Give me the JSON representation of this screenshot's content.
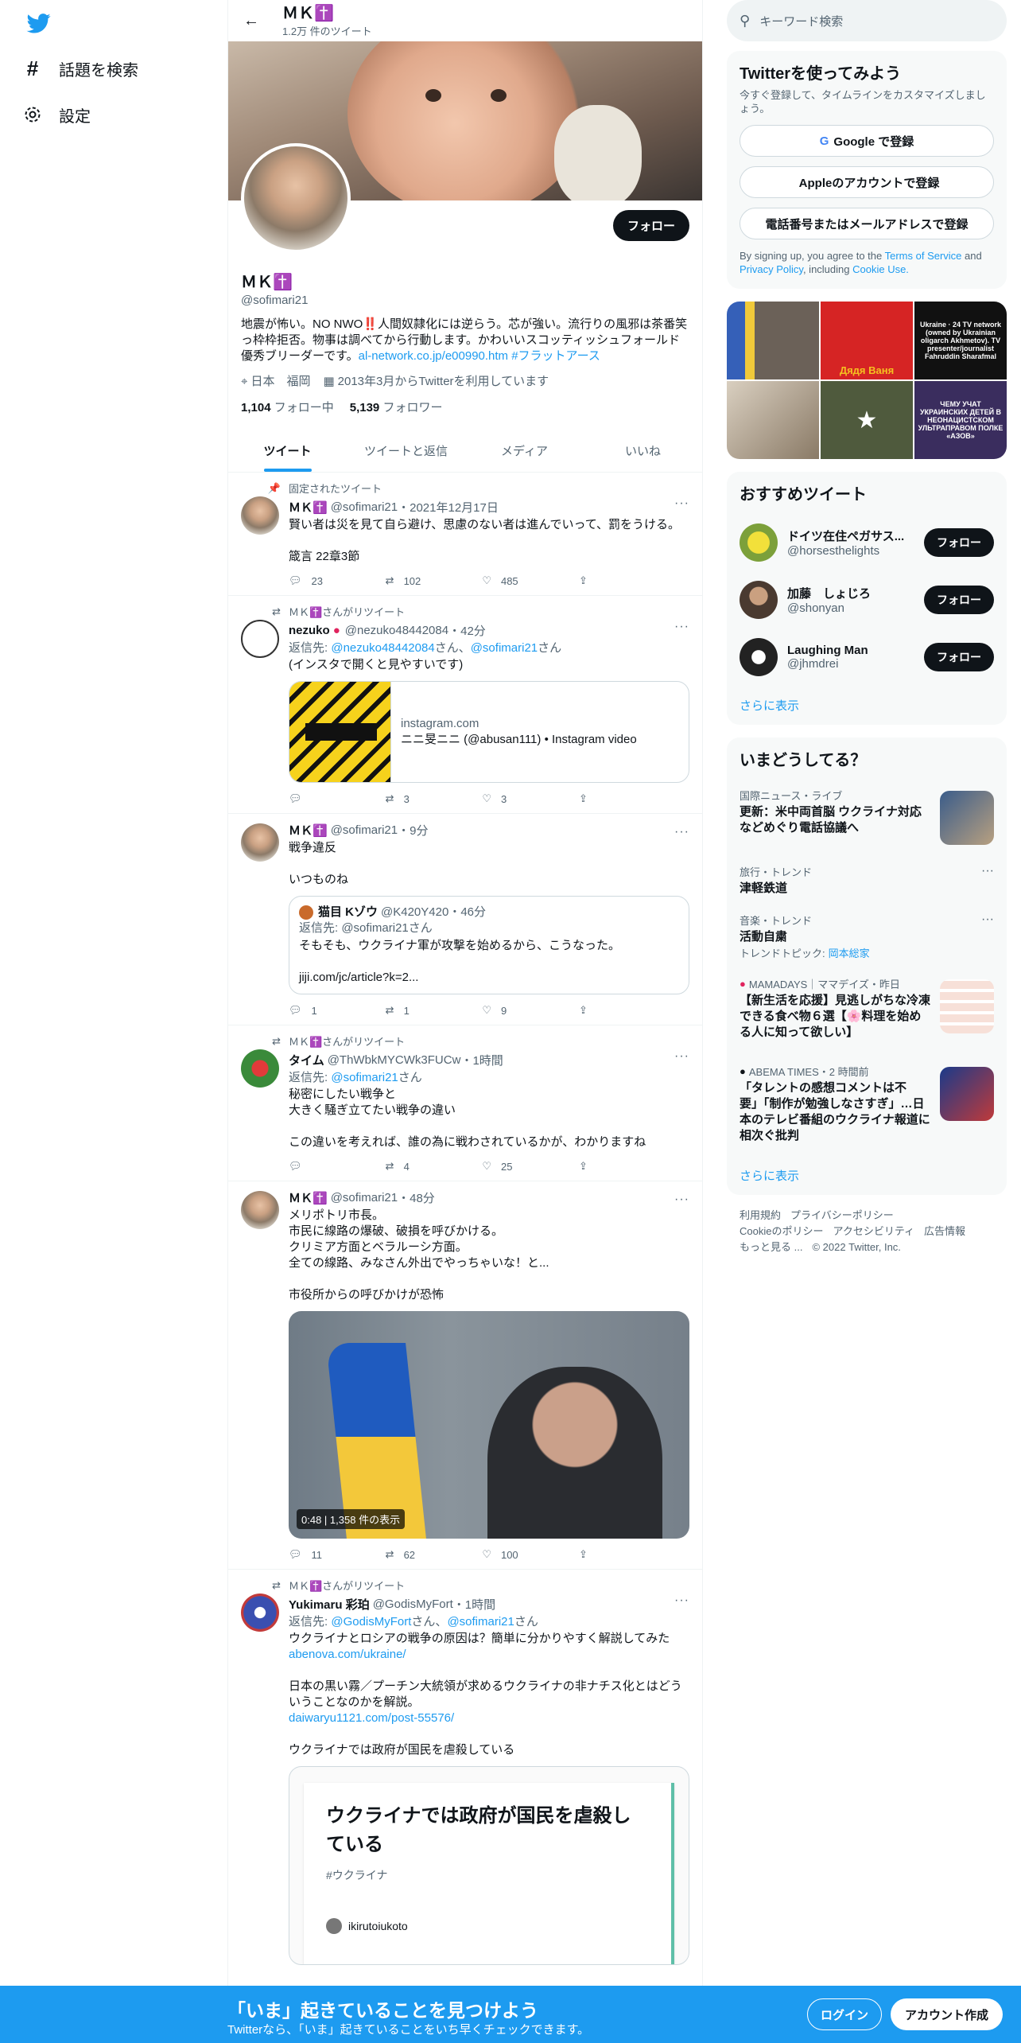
{
  "nav": {
    "explore": "話題を検索",
    "settings": "設定"
  },
  "header": {
    "name": "ＭＫ✝️",
    "tweet_count": "1.2万 件のツイート"
  },
  "profile": {
    "follow_label": "フォロー",
    "name": "ＭＫ✝️",
    "handle": "@sofimari21",
    "bio_text": "地震が怖い。NO NWO‼️人間奴隷化には逆らう。芯が強い。流行りの風邪は茶番笑っ枠枠拒否。物事は調べてから行動します。かわいいスコッティッシュフォールド優秀ブリーダーです。",
    "bio_link": "al-network.co.jp/e00990.htm",
    "bio_hashtag": "#フラットアース",
    "location": "日本　福岡",
    "joined": "2013年3月からTwitterを利用しています",
    "following_count": "1,104",
    "following_label": "フォロー中",
    "followers_count": "5,139",
    "followers_label": "フォロワー"
  },
  "tabs": [
    "ツイート",
    "ツイートと返信",
    "メディア",
    "いいね"
  ],
  "tweets": [
    {
      "social": "固定されたツイート",
      "name": "ＭＫ✝️",
      "handle": "@sofimari21",
      "time": "2021年12月17日",
      "text": "賢い者は災を見て自ら避け、思慮のない者は進んでいって、罰をうける。\n\n箴言 22章3節",
      "replies": "23",
      "retweets": "102",
      "likes": "485"
    },
    {
      "social": "ＭＫ✝️さんがリツイート",
      "name": "nezuko",
      "handle": "@nezuko48442084",
      "time": "42分",
      "reply_prefix": "返信先: ",
      "reply_to1": "@nezuko48442084",
      "reply_mid": "さん、",
      "reply_to2": "@sofimari21",
      "reply_suffix": "さん",
      "text": "(インスタで開くと見やすいです)",
      "card_domain": "instagram.com",
      "card_title": "ニニ旻ニニ (@abusan111) • Instagram video",
      "replies": "",
      "retweets": "3",
      "likes": "3"
    },
    {
      "name": "ＭＫ✝️",
      "handle": "@sofimari21",
      "time": "9分",
      "text": "戦争違反\n\nいつものね",
      "quote_name": "猫目 Kゾウ",
      "quote_handle": "@K420Y420",
      "quote_time": "46分",
      "quote_reply": "返信先: @sofimari21さん",
      "quote_text": "そもそも、ウクライナ軍が攻撃を始めるから、こうなった。\n\njiji.com/jc/article?k=2...",
      "replies": "1",
      "retweets": "1",
      "likes": "9"
    },
    {
      "social": "ＭＫ✝️さんがリツイート",
      "name": "タイム",
      "handle": "@ThWbkMYCWk3FUCw",
      "time": "1時間",
      "reply_prefix": "返信先: ",
      "reply_to1": "@sofimari21",
      "reply_suffix": "さん",
      "text": "秘密にしたい戦争と\n大きく騒ぎ立てたい戦争の違い\n\nこの違いを考えれば、誰の為に戦わされているかが、わかりますね",
      "replies": "",
      "retweets": "4",
      "likes": "25"
    },
    {
      "name": "ＭＫ✝️",
      "handle": "@sofimari21",
      "time": "48分",
      "text": "メリポトリ市長。\n市民に線路の爆破、破損を呼びかける。\nクリミア方面とベラルーシ方面。\n全ての線路、みなさん外出でやっちゃいな！と...\n\n市役所からの呼びかけが恐怖",
      "video_duration": "0:48",
      "video_views": "1,358 件の表示",
      "replies": "11",
      "retweets": "62",
      "likes": "100"
    },
    {
      "social": "ＭＫ✝️さんがリツイート",
      "name": "Yukimaru 彩珀",
      "handle": "@GodisMyFort",
      "time": "1時間",
      "reply_prefix": "返信先: ",
      "reply_to1": "@GodisMyFort",
      "reply_mid": "さん、",
      "reply_to2": "@sofimari21",
      "reply_suffix": "さん",
      "text1": "ウクライナとロシアの戦争の原因は？簡単に分かりやすく解説してみた",
      "link1": "abenova.com/ukraine/",
      "text2": "日本の黒い霧／プーチン大統領が求めるウクライナの非ナチス化とはどういうことなのかを解説。",
      "link2": "daiwaryu1121.com/post-55576/",
      "text3": "ウクライナでは政府が国民を虐殺している",
      "article_title": "ウクライナでは政府が国民を虐殺している",
      "article_tag": "#ウクライナ",
      "article_author": "ikirutoiukoto"
    }
  ],
  "sidebar": {
    "search_placeholder": "キーワード検索",
    "join_title": "Twitterを使ってみよう",
    "join_sub": "今すぐ登録して、タイムラインをカスタマイズしましょう。",
    "google_btn": "Google で登録",
    "apple_btn": "Appleのアカウントで登録",
    "phone_btn": "電話番号またはメールアドレスで登録",
    "terms_prefix": "By signing up, you agree to the ",
    "terms_link": "Terms of Service",
    "terms_and": " and ",
    "privacy_link": "Privacy Policy",
    "terms_including": ", including ",
    "cookie_link": "Cookie Use.",
    "media_captions": [
      "",
      "Дядя Ваня",
      "Ukraine · 24 TV network (owned by Ukrainian oligarch Akhmetov). TV presenter/journalist Fahruddin Sharafmal",
      "",
      "",
      "ЧЕМУ УЧАТ УКРАИНСКИХ ДЕТЕЙ В НЕОНАЦИСТСКОМ УЛЬТРАПРАВОМ ПОЛКЕ «АЗОВ»"
    ],
    "recommend_title": "おすすめツイート",
    "recommend": [
      {
        "name": "ドイツ在住ペガサス...",
        "handle": "@horsesthelights"
      },
      {
        "name": "加藤　しょじろ",
        "handle": "@shonyan"
      },
      {
        "name": "Laughing Man",
        "handle": "@jhmdrei"
      }
    ],
    "recommend_follow": "フォロー",
    "show_more": "さらに表示",
    "trends_title": "いまどうしてる？",
    "trends": [
      {
        "category": "国際ニュース・ライブ",
        "title": "更新：米中両首脳 ウクライナ対応などめぐり電話協議へ"
      },
      {
        "category": "旅行・トレンド",
        "title": "津軽鉄道"
      },
      {
        "category": "音楽・トレンド",
        "title": "活動自粛",
        "sub": "トレンドトピック: ",
        "sub_link": "岡本総家"
      },
      {
        "category": "MAMADAYS｜ママデイズ・昨日",
        "title": "【新生活を応援】見逃しがちな冷凍できる食べ物６選【🌸料理を始める人に知って欲しい】"
      },
      {
        "category": "ABEMA TIMES・2 時間前",
        "title": "「タレントの感想コメントは不要」「制作が勉強しなさすぎ」…日本のテレビ番組のウクライナ報道に相次ぐ批判"
      }
    ],
    "footer": [
      "利用規約",
      "プライバシーポリシー",
      "Cookieのポリシー",
      "アクセシビリティ",
      "広告情報",
      "もっと見る ...",
      "© 2022 Twitter, Inc."
    ]
  },
  "bottom": {
    "title": "「いま」起きていることを見つけよう",
    "sub": "Twitterなら、「いま」起きていることをいち早くチェックできます。",
    "login": "ログイン",
    "signup": "アカウント作成"
  },
  "colors": {
    "accent": "#1d9bf0",
    "text": "#0f1419",
    "muted": "#536471"
  }
}
